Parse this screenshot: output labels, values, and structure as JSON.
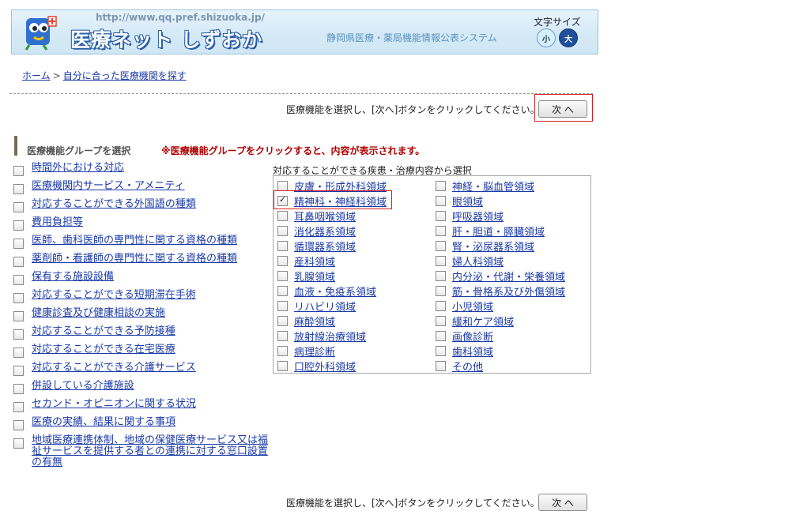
{
  "header": {
    "url": "http://www.qq.pref.shizuoka.jp/",
    "title": "医療ネット しずおか",
    "subtitle": "静岡県医療・薬局機能情報公表システム",
    "font_size_label": "文字サイズ",
    "font_small": "小",
    "font_large": "大"
  },
  "breadcrumb": {
    "home": "ホーム",
    "separator": ">",
    "current": "自分に合った医療機関を探す"
  },
  "instruction": {
    "text": "医療機能を選択し、[次へ]ボタンをクリックしてください。→",
    "next_label": "次 へ"
  },
  "section": {
    "title": "医療機能グループを選択",
    "note": "※医療機能グループをクリックすると、内容が表示されます。"
  },
  "groups": [
    "時間外における対応",
    "医療機関内サービス・アメニティ",
    "対応することができる外国語の種類",
    "費用負担等",
    "医師、歯科医師の専門性に関する資格の種類",
    "薬剤師・看護師の専門性に関する資格の種類",
    "保有する施設設備",
    "対応することができる短期滞在手術",
    "健康診査及び健康相談の実施",
    "対応することができる予防接種",
    "対応することができる在宅医療",
    "対応することができる介護サービス",
    "併設している介護施設",
    "セカンド・オピニオンに関する状況",
    "医療の実績、結果に関する事項",
    "地域医療連携体制、地域の保健医療サービス又は福祉サービスを提供する者との連携に対する窓口設置の有無"
  ],
  "disease_panel": {
    "title": "対応することができる疾患・治療内容から選択",
    "left": [
      {
        "label": "皮膚・形成外科領域",
        "checked": false
      },
      {
        "label": "精神科・神経科領域",
        "checked": true
      },
      {
        "label": "耳鼻咽喉領域",
        "checked": false
      },
      {
        "label": "消化器系領域",
        "checked": false
      },
      {
        "label": "循環器系領域",
        "checked": false
      },
      {
        "label": "産科領域",
        "checked": false
      },
      {
        "label": "乳腺領域",
        "checked": false
      },
      {
        "label": "血液・免疫系領域",
        "checked": false
      },
      {
        "label": "リハビリ領域",
        "checked": false
      },
      {
        "label": "麻酔領域",
        "checked": false
      },
      {
        "label": "放射線治療領域",
        "checked": false
      },
      {
        "label": "病理診断",
        "checked": false
      },
      {
        "label": "口腔外科領域",
        "checked": false
      }
    ],
    "right": [
      {
        "label": "神経・脳血管領域",
        "checked": false
      },
      {
        "label": "眼領域",
        "checked": false
      },
      {
        "label": "呼吸器領域",
        "checked": false
      },
      {
        "label": "肝・胆道・膵臓領域",
        "checked": false
      },
      {
        "label": "腎・泌尿器系領域",
        "checked": false
      },
      {
        "label": "婦人科領域",
        "checked": false
      },
      {
        "label": "内分泌・代謝・栄養領域",
        "checked": false
      },
      {
        "label": "筋・骨格系及び外傷領域",
        "checked": false
      },
      {
        "label": "小児領域",
        "checked": false
      },
      {
        "label": "緩和ケア領域",
        "checked": false
      },
      {
        "label": "画像診断",
        "checked": false
      },
      {
        "label": "歯科領域",
        "checked": false
      },
      {
        "label": "その他",
        "checked": false
      }
    ]
  },
  "colors": {
    "link": "#1a3aa8",
    "highlight_box": "#d62020",
    "note_text": "#b00000",
    "header_bg": "#d5eaf6"
  }
}
